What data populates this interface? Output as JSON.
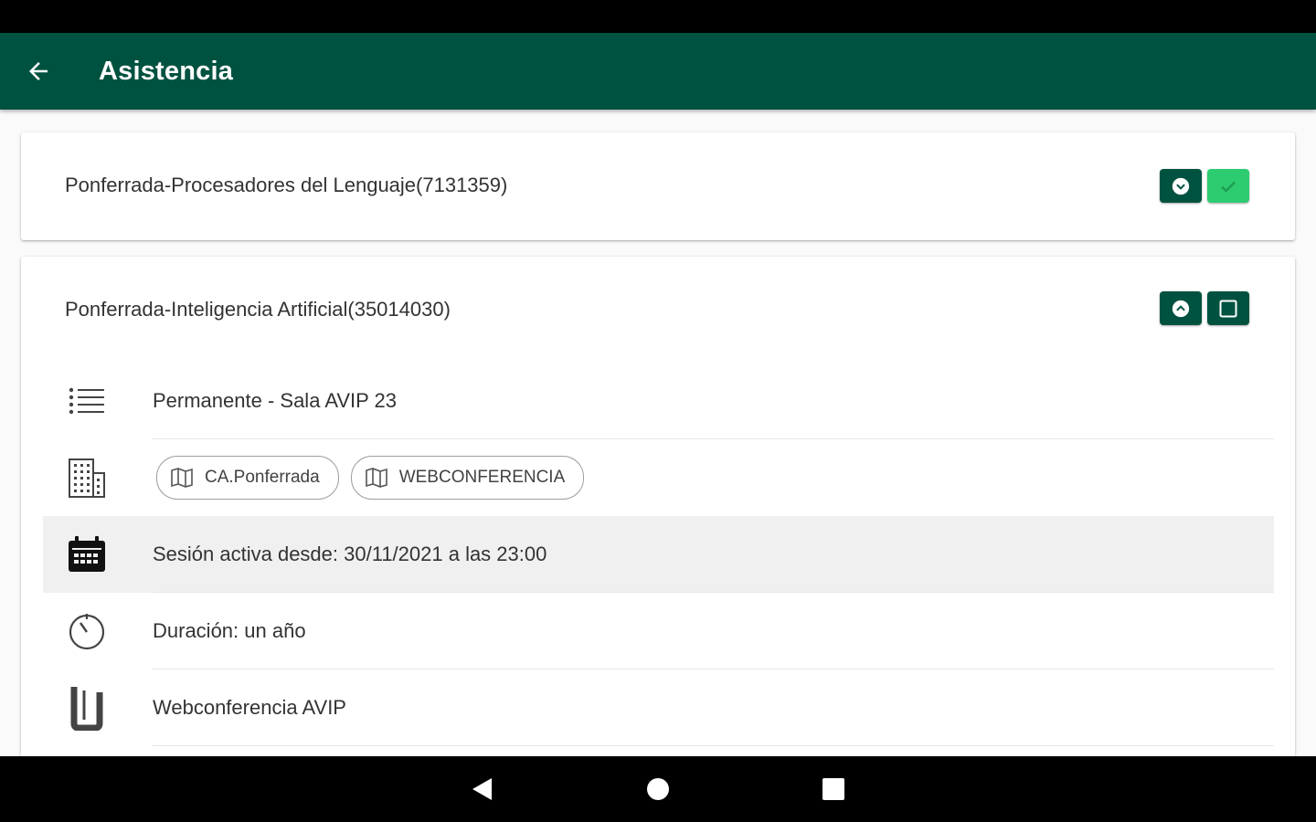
{
  "app_bar": {
    "title": "Asistencia",
    "back_icon": "arrow-back-icon"
  },
  "colors": {
    "primary": "#005240",
    "accent_green": "#2ecc71",
    "background": "#fafafa"
  },
  "courses": [
    {
      "title": "Ponferrada-Procesadores del Lenguaje(7131359)",
      "expanded": false,
      "attendance_checked": true
    },
    {
      "title": "Ponferrada-Inteligencia Artificial(35014030)",
      "expanded": true,
      "attendance_checked": false,
      "details": {
        "type": "Permanente - Sala AVIP 23",
        "locations": [
          "CA.Ponferrada",
          "WEBCONFERENCIA"
        ],
        "session": "Sesión activa desde: 30/11/2021 a las 23:00",
        "duration": "Duración: un año",
        "platform": "Webconferencia AVIP"
      }
    }
  ],
  "icons": {
    "list": "list-icon",
    "building": "building-icon",
    "map": "map-icon",
    "calendar": "calendar-icon",
    "timer": "timer-icon",
    "platform": "avip-logo-icon",
    "expand": "chevron-down-icon",
    "collapse": "chevron-up-icon",
    "checked": "checkbox-checked-icon",
    "unchecked": "checkbox-unchecked-icon"
  }
}
